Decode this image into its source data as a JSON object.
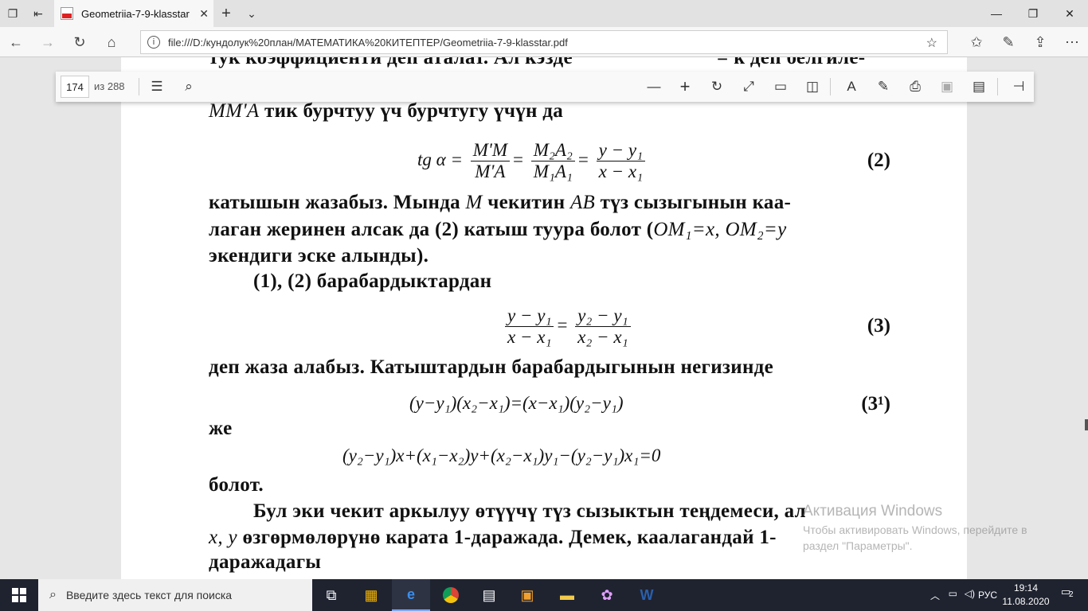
{
  "browser": {
    "tab_title": "Geometriia-7-9-klasstar",
    "tab_close": "✕",
    "new_tab": "+",
    "tab_menu": "⌄",
    "url": "file:///D:/кундолук%20план/МАТЕМАТИКА%20КИТЕПТЕР/Geometriia-7-9-klasstar.pdf",
    "window_controls": [
      "—",
      "❐",
      "✕"
    ]
  },
  "pdf_toolbar": {
    "current_page": "174",
    "total_pages": "из 288"
  },
  "document": {
    "line_top": "тук коэффициенти деп аталат. Ал кэзде",
    "line_top_right": "= k  деп белгиле-",
    "line1_it": "MM'A",
    "line1_rest": " тик бурчтуу үч бурчтугу үчүн да",
    "eq2_lhs": "tg α =",
    "eq2_f1_n": "M'M",
    "eq2_f1_d": "M'A",
    "eq2_f2_n": "M₂A₂",
    "eq2_f2_d": "M₁A₁",
    "eq2_f3_n": "y − y₁",
    "eq2_f3_d": "x − x₁",
    "eq2_no": "(2)",
    "p1_l1a": "катышын жазабыз. Мында ",
    "p1_l1b": "M",
    "p1_l1c": " чекитин ",
    "p1_l1d": "AB",
    "p1_l1e": " түз сызыгынын каа-",
    "p1_l2a": "лаган жеринен алсак да (2) катыш туура болот (",
    "p1_l2b": "OM₁=x, OM₂=y",
    "p1_l3": "экендиги эске алынды).",
    "p2": "(1), (2) барабардыктардан",
    "eq3_f1_n": "y − y₁",
    "eq3_f1_d": "x − x₁",
    "eq3_f2_n": "y₂ − y₁",
    "eq3_f2_d": "x₂ − x₁",
    "eq3_no": "(3)",
    "p3": "деп жаза алабыз. Катыштардын барабардыгынын негизинде",
    "eq31": "(y−y₁)(x₂−x₁)=(x−x₁)(y₂−y₁)",
    "eq31_no": "(3¹)",
    "p4": "же",
    "eq4": "(y₂−y₁)x+(x₁−x₂)y+(x₂−x₁)y₁−(y₂−y₁)x₁=0",
    "p5": "болот.",
    "p6_l1": "Бул эки чекит аркылуу өтүүчү түз сызыктын теңдемеси, ал",
    "p6_l2a": "x, y",
    "p6_l2b": " өзгөрмөлөрүнө карата 1-даражада. Демек, каалагандай 1-",
    "p6_l3": "даражадагы"
  },
  "watermark": {
    "title": "Активация Windows",
    "subtitle": "Чтобы активировать Windows, перейдите в раздел \"Параметры\"."
  },
  "taskbar": {
    "search_placeholder": "Введите здесь текст для поиска",
    "lang": "РУС",
    "time": "19:14",
    "date": "11.08.2020",
    "notif_count": "2"
  }
}
